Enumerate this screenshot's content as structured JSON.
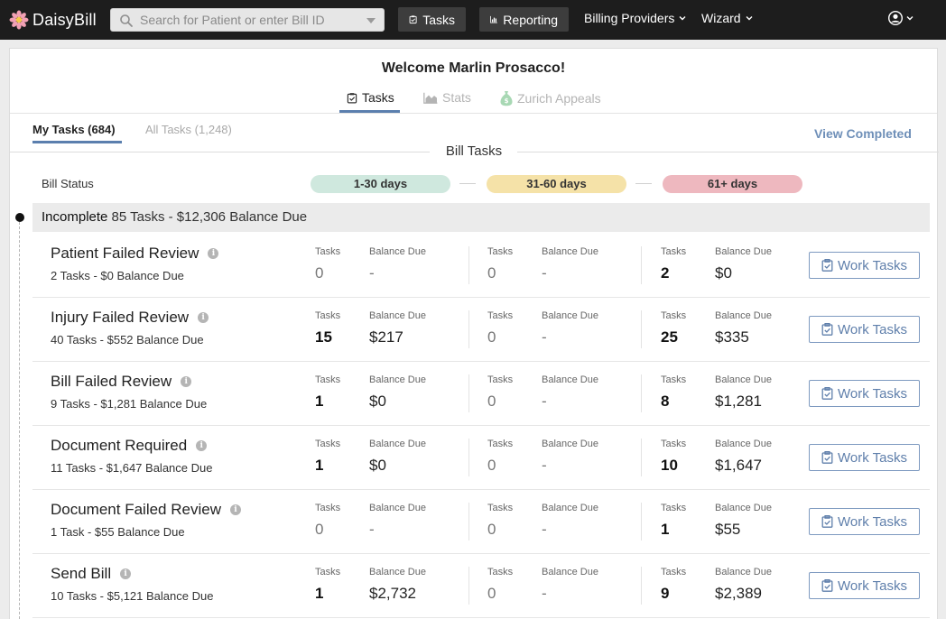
{
  "nav": {
    "brand": "DaisyBill",
    "search_placeholder": "Search for Patient or enter Bill ID",
    "tasks_label": "Tasks",
    "reporting_label": "Reporting",
    "billing_providers_label": "Billing Providers",
    "wizard_label": "Wizard"
  },
  "welcome": "Welcome Marlin Prosacco!",
  "tabs": [
    {
      "label": "Tasks"
    },
    {
      "label": "Stats"
    },
    {
      "label": "Zurich Appeals"
    }
  ],
  "subtabs": {
    "my_tasks": "My Tasks (684)",
    "all_tasks": "All Tasks (1,248)",
    "view_completed": "View Completed"
  },
  "section_title": "Bill Tasks",
  "bill_status_label": "Bill Status",
  "buckets": [
    {
      "label": "1-30 days",
      "color": "#cfe8de"
    },
    {
      "label": "31-60 days",
      "color": "#f5e2a8"
    },
    {
      "label": "61+ days",
      "color": "#eeb8bf"
    }
  ],
  "incomplete": {
    "label": "Incomplete",
    "summary": "85 Tasks - $12,306 Balance Due"
  },
  "column_labels": {
    "tasks": "Tasks",
    "balance": "Balance Due"
  },
  "work_tasks_label": "Work Tasks",
  "rows": [
    {
      "title": "Patient Failed Review",
      "subtitle": "2 Tasks - $0 Balance Due",
      "b1_tasks": "0",
      "b1_balance": "-",
      "b2_tasks": "0",
      "b2_balance": "-",
      "b3_tasks": "2",
      "b3_balance": "$0"
    },
    {
      "title": "Injury Failed Review",
      "subtitle": "40 Tasks - $552 Balance Due",
      "b1_tasks": "15",
      "b1_balance": "$217",
      "b2_tasks": "0",
      "b2_balance": "-",
      "b3_tasks": "25",
      "b3_balance": "$335"
    },
    {
      "title": "Bill Failed Review",
      "subtitle": "9 Tasks - $1,281 Balance Due",
      "b1_tasks": "1",
      "b1_balance": "$0",
      "b2_tasks": "0",
      "b2_balance": "-",
      "b3_tasks": "8",
      "b3_balance": "$1,281"
    },
    {
      "title": "Document Required",
      "subtitle": "11 Tasks - $1,647 Balance Due",
      "b1_tasks": "1",
      "b1_balance": "$0",
      "b2_tasks": "0",
      "b2_balance": "-",
      "b3_tasks": "10",
      "b3_balance": "$1,647"
    },
    {
      "title": "Document Failed Review",
      "subtitle": "1 Task - $55 Balance Due",
      "b1_tasks": "0",
      "b1_balance": "-",
      "b2_tasks": "0",
      "b2_balance": "-",
      "b3_tasks": "1",
      "b3_balance": "$55"
    },
    {
      "title": "Send Bill",
      "subtitle": "10 Tasks - $5,121 Balance Due",
      "b1_tasks": "1",
      "b1_balance": "$2,732",
      "b2_tasks": "0",
      "b2_balance": "-",
      "b3_tasks": "9",
      "b3_balance": "$2,389"
    }
  ],
  "colors": {
    "accent": "#5b7fae",
    "nav_bg": "#1d1d1d"
  }
}
